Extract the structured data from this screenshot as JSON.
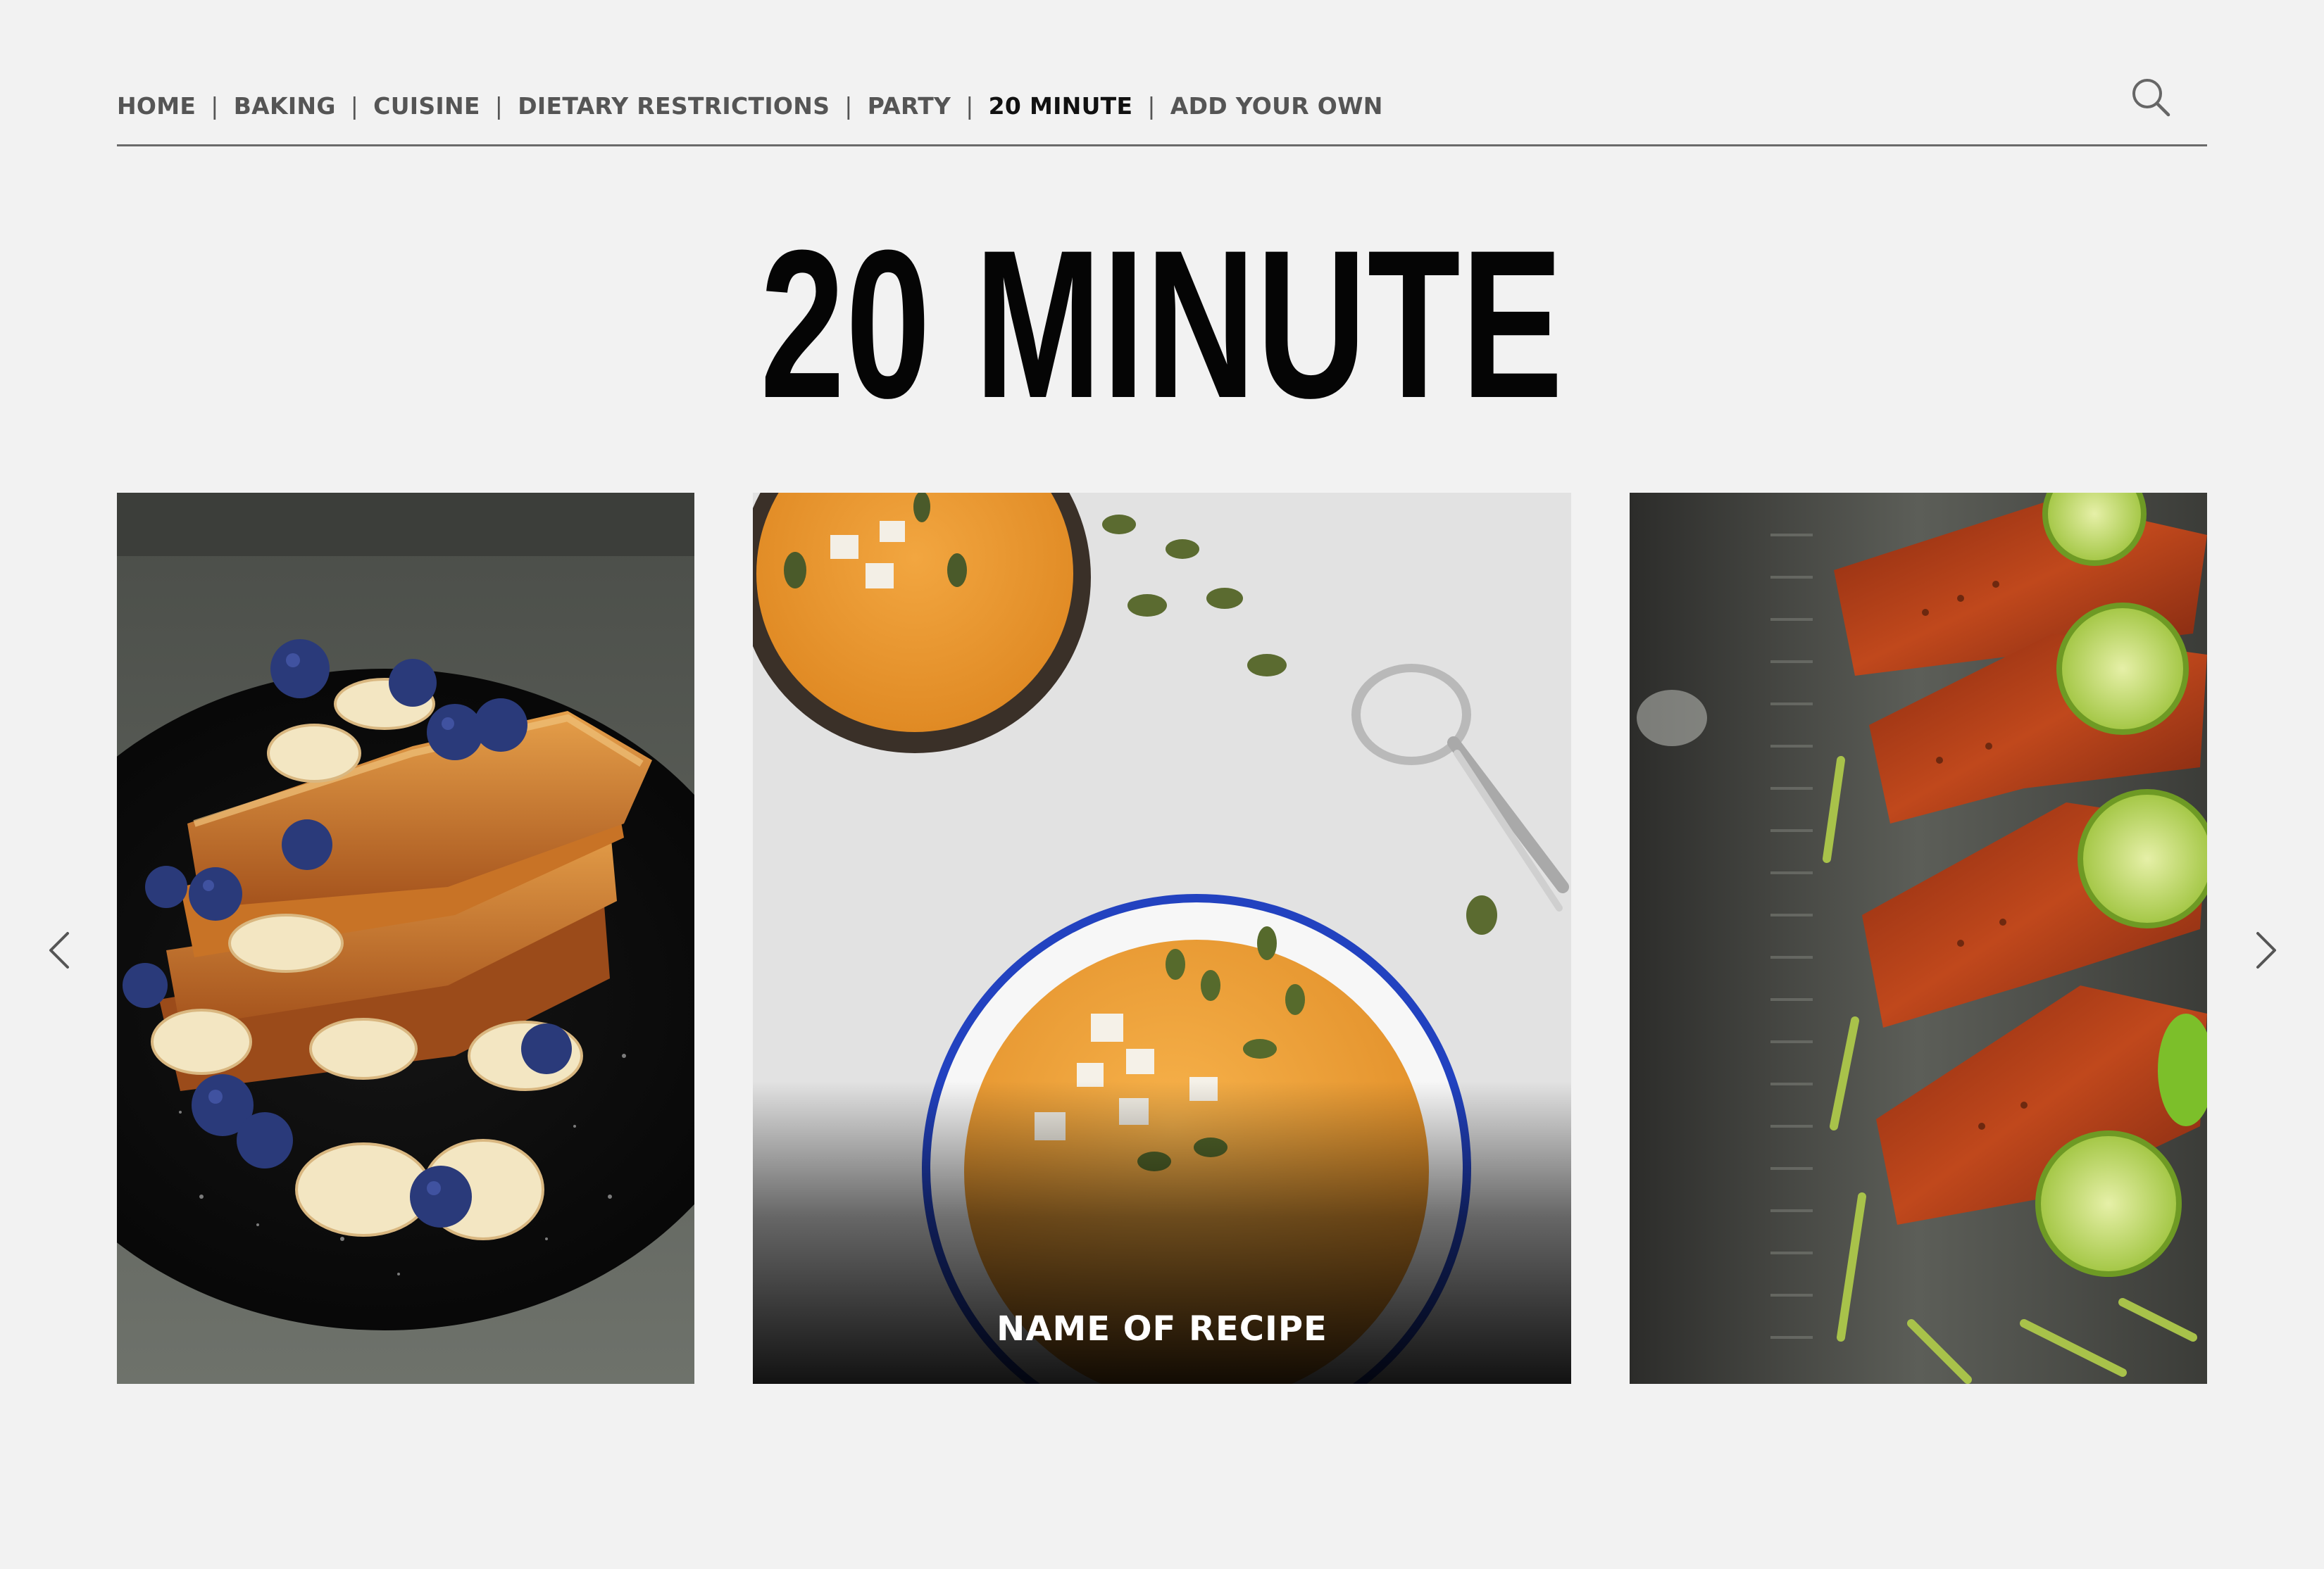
{
  "nav": {
    "items": [
      {
        "label": "HOME"
      },
      {
        "label": "BAKING"
      },
      {
        "label": "CUISINE"
      },
      {
        "label": "DIETARY RESTRICTIONS"
      },
      {
        "label": "PARTY"
      },
      {
        "label": "20 MINUTE",
        "active": true
      },
      {
        "label": "ADD YOUR OWN"
      }
    ],
    "separator": "|",
    "search_icon": "search-icon"
  },
  "page": {
    "title": "20 MINUTE"
  },
  "carousel": {
    "prev_icon": "chevron-left-icon",
    "next_icon": "chevron-right-icon",
    "cards": [
      {
        "image": "french-toast-blueberries-banana-photo"
      },
      {
        "image": "pumpkin-soup-bowls-photo",
        "caption": "NAME OF RECIPE",
        "focused": true
      },
      {
        "image": "glazed-salmon-lime-zucchini-photo"
      }
    ]
  },
  "colors": {
    "background": "#f2f2f2",
    "nav_text": "#555555",
    "nav_active": "#111111",
    "title": "#050505",
    "caption": "#ffffff"
  }
}
